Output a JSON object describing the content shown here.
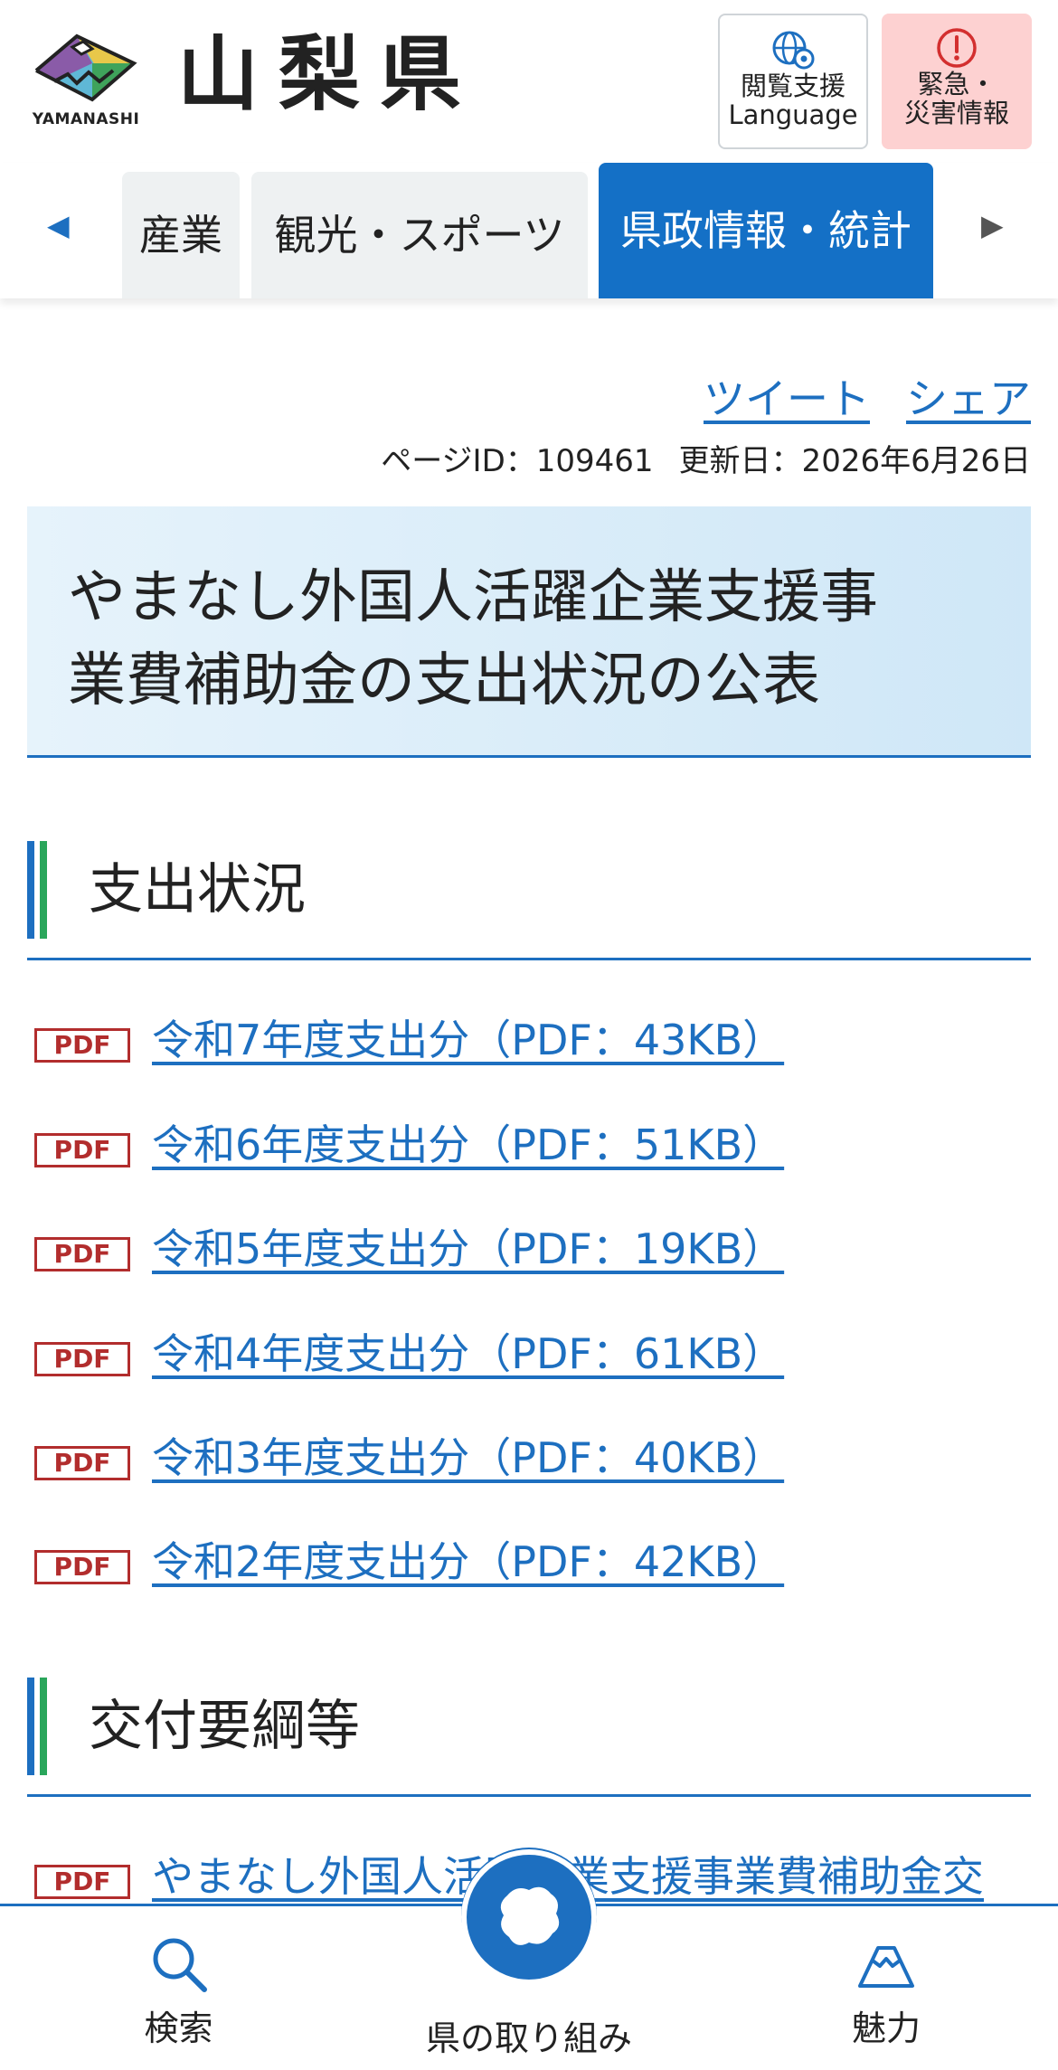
{
  "header": {
    "logo_text": "YAMANASHI",
    "site_name": "山梨県",
    "access_button": {
      "line1": "閲覧支援",
      "line2": "Language",
      "icon": "globe-gear-icon"
    },
    "emergency_button": {
      "line1": "緊急・",
      "line2": "災害情報",
      "icon": "alert-circle-icon"
    }
  },
  "tabs": {
    "items": [
      {
        "label": "産業"
      },
      {
        "label": "観光・スポーツ"
      },
      {
        "label": "県政情報・統計",
        "active": true
      }
    ],
    "prev_arrow": "◀",
    "next_arrow": "▶"
  },
  "share": {
    "tweet": "ツイート",
    "share": "シェア"
  },
  "meta": {
    "page_id": "ページID：109461",
    "updated": "更新日：2026年6月26日"
  },
  "title": {
    "line1": "やまなし外国人活躍企業支援事",
    "line2": "業費補助金の支出状況の公表"
  },
  "sections": [
    {
      "heading": "支出状況",
      "files": [
        {
          "badge": "PDF",
          "label": "令和7年度支出分（PDF：43KB）"
        },
        {
          "badge": "PDF",
          "label": "令和6年度支出分（PDF：51KB）"
        },
        {
          "badge": "PDF",
          "label": "令和5年度支出分（PDF：19KB）"
        },
        {
          "badge": "PDF",
          "label": "令和4年度支出分（PDF：61KB）"
        },
        {
          "badge": "PDF",
          "label": "令和3年度支出分（PDF：40KB）"
        },
        {
          "badge": "PDF",
          "label": "令和2年度支出分（PDF：42KB）"
        }
      ]
    },
    {
      "heading": "交付要綱等",
      "files": [
        {
          "badge": "PDF",
          "label": "やまなし外国人活躍企業支援事業費補助金交"
        }
      ]
    }
  ],
  "bottom_nav": {
    "search": "検索",
    "center": "県の取り組み",
    "charm": "魅力"
  },
  "colors": {
    "accent": "#1d6fc0",
    "active_tab": "#1470c6",
    "emergency_bg": "#fdd1d1",
    "pdf_red": "#b22d2d",
    "green_bar": "#2aa65b"
  }
}
